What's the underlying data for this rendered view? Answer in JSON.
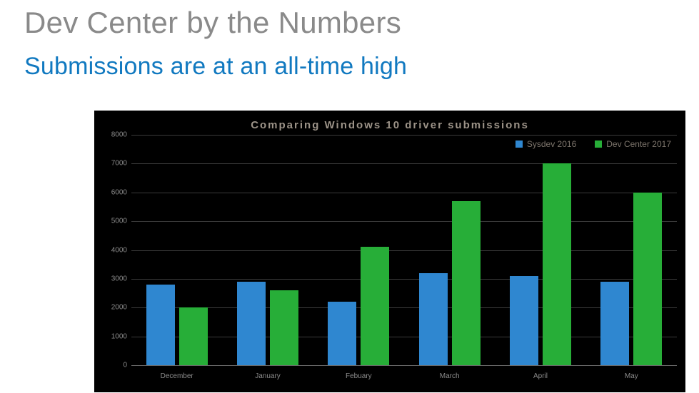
{
  "page": {
    "title": "Dev Center by the Numbers",
    "subtitle": "Submissions are at an all-time high"
  },
  "chart_data": {
    "type": "bar",
    "title": "Comparing Windows 10 driver submissions",
    "categories": [
      "December",
      "January",
      "Febuary",
      "March",
      "April",
      "May"
    ],
    "series": [
      {
        "name": "Sysdev 2016",
        "color": "#2f87d0",
        "values": [
          2800,
          2900,
          2200,
          3200,
          3100,
          2900
        ]
      },
      {
        "name": "Dev Center 2017",
        "color": "#27ae38",
        "values": [
          2000,
          2600,
          4100,
          5700,
          7000,
          6000
        ]
      }
    ],
    "ylim": [
      0,
      8000
    ],
    "ystep": 1000,
    "xlabel": "",
    "ylabel": ""
  }
}
